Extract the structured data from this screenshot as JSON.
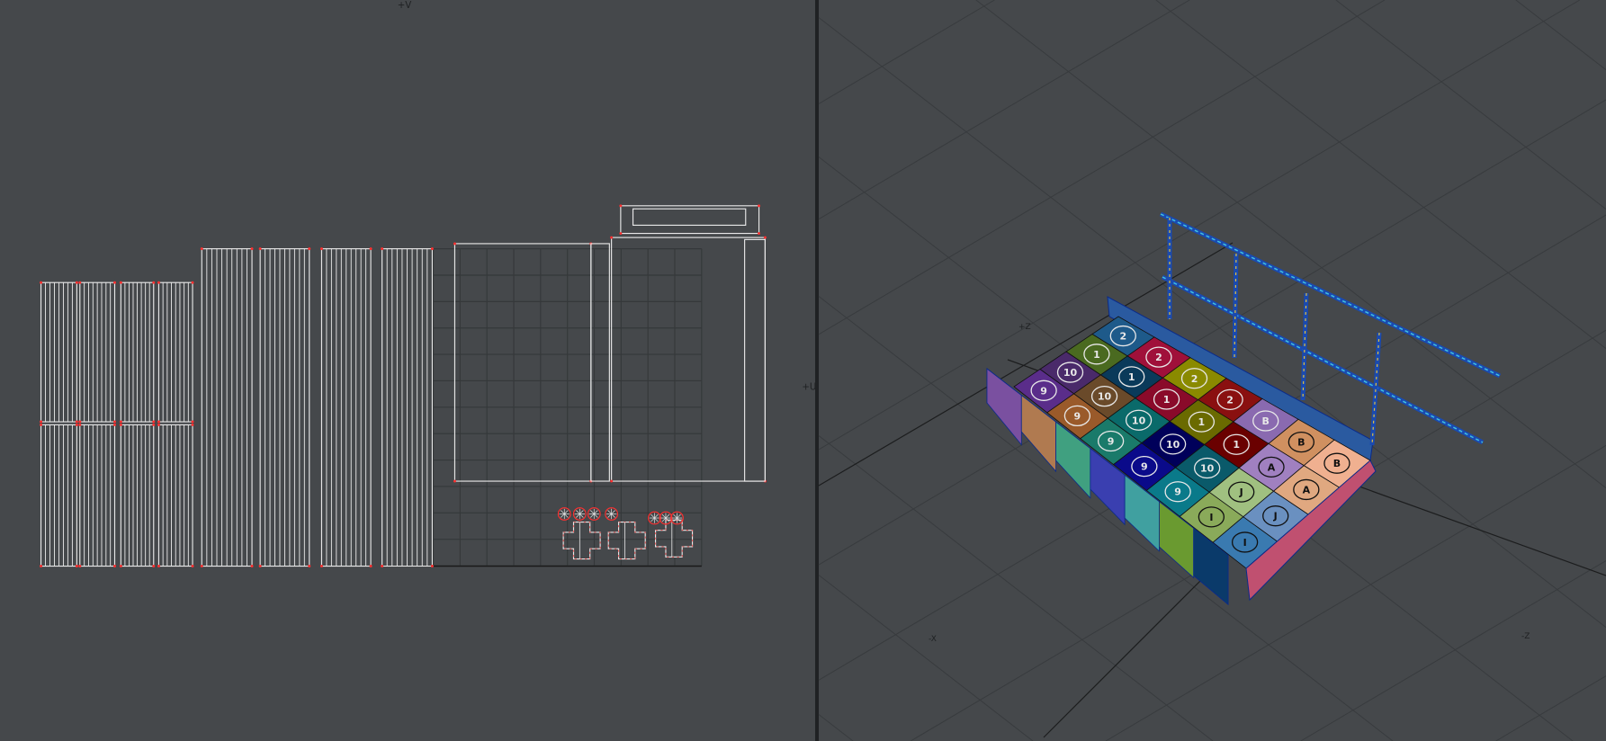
{
  "uv_viewport": {
    "axis_v_label": "+V",
    "axis_u_label": "+U"
  },
  "viewport_3d": {
    "axis_z_pos_label": "+Z",
    "axis_x_neg_label": "-X",
    "axis_z_neg_label": "-Z",
    "tile_labels": [
      [
        "9",
        "10",
        "1",
        "2"
      ],
      [
        "9",
        "10",
        "1",
        "2"
      ],
      [
        "9",
        "10",
        "1",
        "2"
      ],
      [
        "9",
        "10",
        "1",
        "2"
      ],
      [
        "9",
        "10",
        "1",
        "B"
      ],
      [
        "I",
        "J",
        "A",
        "B"
      ],
      [
        "I",
        "J",
        "A",
        "B"
      ]
    ],
    "tile_colors": [
      [
        "#5a2d8a",
        "#4a2a6a",
        "#4a6a20",
        "#1e5a8a"
      ],
      [
        "#9a5a2a",
        "#6a4a2a",
        "#0a3a5a",
        "#a0103a"
      ],
      [
        "#1a7a6a",
        "#0a6a6a",
        "#8a0a2a",
        "#8a8a00"
      ],
      [
        "#0a0a8a",
        "#00005a",
        "#6a6a00",
        "#8a1010"
      ],
      [
        "#0a7a8a",
        "#0a5a6a",
        "#6a0000",
        "#8a6ab0"
      ],
      [
        "#8aaa5a",
        "#a0c080",
        "#a080c0",
        "#d09060"
      ],
      [
        "#3a7ab0",
        "#6a90c0",
        "#e0a880",
        "#f0b090"
      ]
    ]
  },
  "colors": {
    "background": "#45484b",
    "uv_edge": "#e8e8e8",
    "uv_seam": "#ff3030",
    "grid": "#35383a",
    "divider": "#202224"
  }
}
